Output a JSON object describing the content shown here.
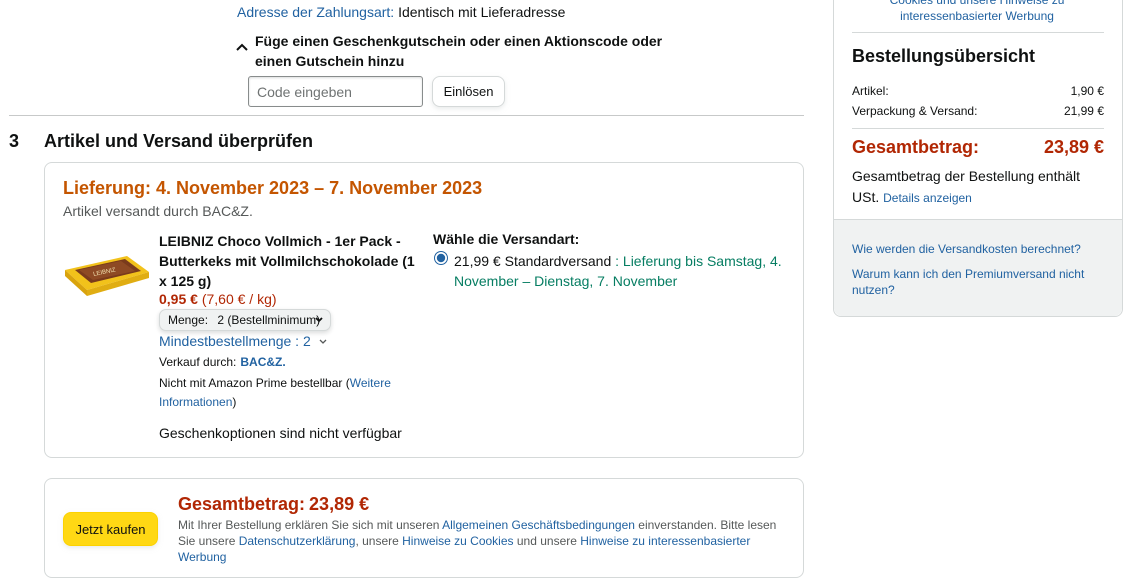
{
  "billing": {
    "label": "Adresse der Zahlungsart:",
    "value": "Identisch mit Lieferadresse"
  },
  "promo": {
    "toggle_icon": "chevron-up-icon",
    "text": "Füge einen Geschenkgutschein oder einen Aktionscode oder einen Gutschein hinzu",
    "placeholder": "Code eingeben",
    "redeem_label": "Einlösen"
  },
  "section3": {
    "number": "3",
    "title": "Artikel und Versand überprüfen",
    "delivery_heading": "Lieferung: 4. November 2023 – 7. November 2023",
    "shipped_by": "Artikel versandt durch BAC&Z.",
    "product": {
      "title": "LEIBNIZ Choco Vollmich - 1er Pack - Butterkeks mit Vollmilchschokolade (1 x 125 g)",
      "price": "0,95 €",
      "unit_price": "(7,60 € / kg)",
      "quantity_label": "Menge:",
      "quantity_value": "2 (Bestellminimum)",
      "min_qty": "Mindestbestellmenge : 2",
      "sold_by_label": "Verkauf durch:",
      "seller": "BAC&Z.",
      "prime_note_pre": "Nicht mit Amazon Prime bestellbar (",
      "prime_note_link": "Weitere Informationen",
      "prime_note_post": ")",
      "gift_note": "Geschenkoptionen sind nicht verfügbar"
    },
    "shipping": {
      "heading": "Wähle die Versandart:",
      "option_price": "21,99 € Standardversand",
      "option_sep": " : ",
      "option_delivery": "Lieferung bis Samstag, 4. November – Dienstag, 7. November",
      "selected": true
    }
  },
  "place_order": {
    "button_label": "Jetzt kaufen",
    "total_label": "Gesamtbetrag:",
    "total_value": "23,89 €",
    "legal": {
      "p1": "Mit Ihrer Bestellung erklären Sie sich mit unseren ",
      "l1": "Allgemeinen Geschäftsbedingungen",
      "p2": " einverstanden. Bitte lesen Sie unsere ",
      "l2": "Datenschutzerklärung",
      "p3": ", unsere ",
      "l3": "Hinweise zu Cookies",
      "p4": " und unsere ",
      "l4": "Hinweise zu interessenbasierter Werbung"
    }
  },
  "summary": {
    "cut_link": "Cookies und unsere Hinweise zu interessenbasierter Werbung",
    "title": "Bestellungsübersicht",
    "rows": [
      {
        "label": "Artikel:",
        "value": "1,90 €"
      },
      {
        "label": "Verpackung & Versand:",
        "value": "21,99 €"
      }
    ],
    "grand_label": "Gesamtbetrag:",
    "grand_value": "23,89 €",
    "vat_note": "Gesamtbetrag der Bestellung enthält USt.",
    "vat_link": "Details anzeigen",
    "faq": [
      "Wie werden die Versandkosten berechnet?",
      "Warum kann ich den Premiumversand nicht nutzen?"
    ]
  },
  "colors": {
    "link": "#2162a1",
    "delivery_orange": "#c45500",
    "price_red": "#b12704",
    "green": "#067d62",
    "buy_yellow": "#ffd814"
  }
}
